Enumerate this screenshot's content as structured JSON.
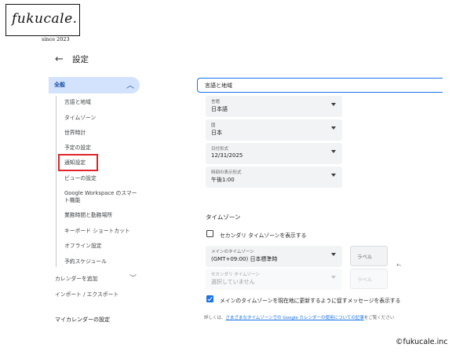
{
  "logo": {
    "text": "fukucale.",
    "subtitle": "since 2023"
  },
  "header": {
    "back_icon": "arrow-left-icon",
    "title": "設定"
  },
  "sidebar": {
    "section_label": "全般",
    "section_icon": "chevron-up-icon",
    "items": [
      "言語と地域",
      "タイムゾーン",
      "世界時計",
      "予定の設定",
      "通知設定",
      "ビューの設定",
      "Google Workspace のスマート機能",
      "業務時間と勤務場所",
      "キーボード ショートカット",
      "オフライン設定",
      "予約スケジュール"
    ],
    "add_calendar": "カレンダーを追加",
    "import_export": "インポート / エクスポート",
    "my_calendars_heading": "マイカレンダーの設定",
    "highlight_color": "#e0242a"
  },
  "main": {
    "section_title": "言語と地域",
    "dropdowns": [
      {
        "label": "言語",
        "value": "日本語"
      },
      {
        "label": "国",
        "value": "日本"
      },
      {
        "label": "日付形式",
        "value": "12/31/2025"
      },
      {
        "label": "時刻の表示形式",
        "value": "午後1:00"
      }
    ],
    "timezone": {
      "title": "タイムゾーン",
      "secondary_checkbox_label": "セカンダリ タイムゾーンを表示する",
      "secondary_checked": false,
      "primary_label": "メインのタイムゾーン",
      "primary_value": "(GMT+09:00) 日本標準時",
      "primary_tag_placeholder": "ラベル",
      "secondary_label": "セカンダリ タイムゾーン",
      "secondary_value": "選択していません",
      "secondary_tag_placeholder": "ラベル",
      "prompt_checkbox_label": "メインのタイムゾーンを現在地に更新するように促すメッセージを表示する",
      "prompt_checked": true,
      "info_prefix": "詳しくは、",
      "info_link": "さまざまなタイムゾーンでの Google カレンダーの使用についての記事",
      "info_suffix": "をご覧ください"
    }
  },
  "copyright": "©fukucale.inc",
  "colors": {
    "accent": "#1a73e8",
    "selected_bg": "#d3e3fd"
  }
}
